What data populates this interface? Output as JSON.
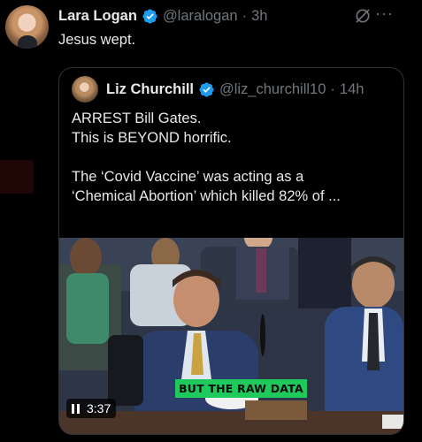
{
  "tweet": {
    "author_name": "Lara Logan",
    "author_handle": "@laralogan",
    "separator": "·",
    "time": "3h",
    "text": "Jesus wept.",
    "more_label": "···"
  },
  "quote": {
    "author_name": "Liz Churchill",
    "author_handle": "@liz_churchill10",
    "separator": "·",
    "time": "14h",
    "lines": [
      "ARREST Bill Gates.",
      "This is BEYOND horrific.",
      "",
      "The ‘Covid Vaccine’ was acting as a",
      "‘Chemical Abortion’ which killed 82% of ..."
    ],
    "video": {
      "caption": "BUT THE RAW DATA",
      "duration": "3:37"
    }
  },
  "colors": {
    "background": "#000000",
    "text": "#e7e9ea",
    "muted": "#71767b",
    "verified": "#1d9bf0",
    "border": "#2f3336",
    "caption_bg": "#1fca5c"
  },
  "icons": [
    "verified-badge-icon",
    "grok-icon",
    "more-icon",
    "pause-icon"
  ]
}
